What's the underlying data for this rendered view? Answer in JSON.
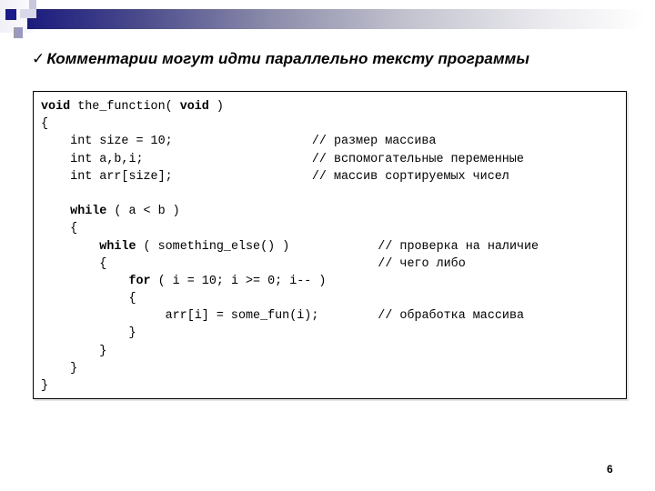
{
  "slide": {
    "title": "Комментарии могут идти параллельно тексту программы",
    "bullet_icon": "check-mark-icon",
    "page_number": "6"
  },
  "code": {
    "lines": [
      {
        "indent": "",
        "kw": "void",
        "text": " the_function( ",
        "kw2": "void",
        "text2": " )",
        "comment": ""
      },
      {
        "indent": "",
        "kw": "",
        "text": "{",
        "comment": ""
      },
      {
        "indent": "    ",
        "kw": "",
        "text": "int size = 10;",
        "comment": "// размер массива"
      },
      {
        "indent": "    ",
        "kw": "",
        "text": "int a,b,i;",
        "comment": "// вспомогательные переменные"
      },
      {
        "indent": "    ",
        "kw": "",
        "text": "int arr[size];",
        "comment": "// массив сортируемых чисел"
      },
      {
        "indent": "",
        "kw": "",
        "text": "",
        "comment": ""
      },
      {
        "indent": "    ",
        "kw": "while",
        "text": " ( a < b )",
        "comment": ""
      },
      {
        "indent": "    ",
        "kw": "",
        "text": "{",
        "comment": ""
      },
      {
        "indent": "        ",
        "kw": "while",
        "text": " ( something_else() )",
        "comment": "// проверка на наличие"
      },
      {
        "indent": "        ",
        "kw": "",
        "text": "{",
        "comment": "// чего либо"
      },
      {
        "indent": "            ",
        "kw": "for",
        "text": " ( i = 10; i >= 0; i-- )",
        "comment": ""
      },
      {
        "indent": "            ",
        "kw": "",
        "text": "{",
        "comment": ""
      },
      {
        "indent": "                 ",
        "kw": "",
        "text": "arr[i] = some_fun(i);",
        "comment": "// обработка массива"
      },
      {
        "indent": "            ",
        "kw": "",
        "text": "}",
        "comment": ""
      },
      {
        "indent": "        ",
        "kw": "",
        "text": "}",
        "comment": ""
      },
      {
        "indent": "    ",
        "kw": "",
        "text": "}",
        "comment": ""
      },
      {
        "indent": "",
        "kw": "",
        "text": "}",
        "comment": ""
      }
    ]
  }
}
